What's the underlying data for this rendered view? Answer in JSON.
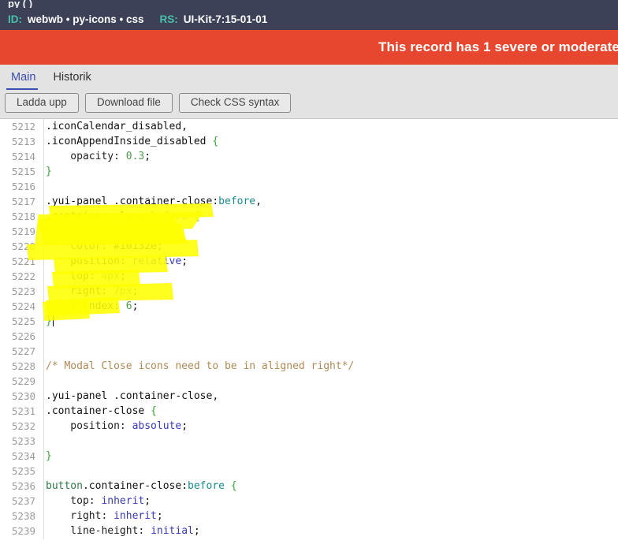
{
  "header": {
    "clipped_top_text": "                    py         (         )",
    "id_label": "ID:",
    "id_value": "webwb • py-icons • css",
    "rs_label": "RS:",
    "rs_value": "UI-Kit-7:15-01-01",
    "background_color": "#3c4158",
    "key_color": "#4bbfae"
  },
  "alert": {
    "text": "This record has 1 severe or moderate",
    "background_color": "#e8472f",
    "text_color": "#ffffff"
  },
  "tabs": [
    {
      "label": "Main",
      "active": true
    },
    {
      "label": "Historik",
      "active": false
    }
  ],
  "toolbar": {
    "buttons": [
      {
        "label": "Ladda upp"
      },
      {
        "label": "Download file"
      },
      {
        "label": "Check CSS syntax"
      }
    ]
  },
  "editor": {
    "first_line_number": 5212,
    "caret_line": 5225,
    "highlight_color": "#ffff00",
    "lines": [
      {
        "n": 5212,
        "tokens": [
          {
            "t": "sel",
            "s": ".iconCalendar_disabled,"
          }
        ]
      },
      {
        "n": 5213,
        "tokens": [
          {
            "t": "sel",
            "s": ".iconAppendInside_disabled "
          },
          {
            "t": "brace",
            "s": "{"
          }
        ]
      },
      {
        "n": 5214,
        "tokens": [
          {
            "t": "prop",
            "s": "    opacity: "
          },
          {
            "t": "num",
            "s": "0.3"
          },
          {
            "t": "plain",
            "s": ";"
          }
        ]
      },
      {
        "n": 5215,
        "tokens": [
          {
            "t": "brace",
            "s": "}"
          }
        ]
      },
      {
        "n": 5216,
        "tokens": []
      },
      {
        "n": 5217,
        "tokens": [
          {
            "t": "sel",
            "s": ".yui-panel .container-close:"
          },
          {
            "t": "pseudo",
            "s": "before"
          },
          {
            "t": "plain",
            "s": ","
          }
        ]
      },
      {
        "n": 5218,
        "tokens": [
          {
            "t": "sel",
            "s": ".container-close:"
          },
          {
            "t": "pseudo",
            "s": "before"
          },
          {
            "t": "plain",
            "s": " "
          },
          {
            "t": "brace",
            "s": "{"
          }
        ]
      },
      {
        "n": 5219,
        "tokens": [
          {
            "t": "prop",
            "s": "    font-size: "
          },
          {
            "t": "num",
            "s": "25px"
          },
          {
            "t": "plain",
            "s": ";"
          }
        ]
      },
      {
        "n": 5220,
        "tokens": [
          {
            "t": "prop",
            "s": "    color: "
          },
          {
            "t": "hex",
            "s": "#10132e"
          },
          {
            "t": "plain",
            "s": ";"
          }
        ]
      },
      {
        "n": 5221,
        "tokens": [
          {
            "t": "prop",
            "s": "    position: "
          },
          {
            "t": "kw",
            "s": "relative"
          },
          {
            "t": "plain",
            "s": ";"
          }
        ]
      },
      {
        "n": 5222,
        "tokens": [
          {
            "t": "prop",
            "s": "    top: "
          },
          {
            "t": "num",
            "s": "4px"
          },
          {
            "t": "plain",
            "s": ";"
          }
        ]
      },
      {
        "n": 5223,
        "tokens": [
          {
            "t": "prop",
            "s": "    right: "
          },
          {
            "t": "num",
            "s": "7px"
          },
          {
            "t": "plain",
            "s": ";"
          }
        ]
      },
      {
        "n": 5224,
        "tokens": [
          {
            "t": "prop",
            "s": "    z-index: "
          },
          {
            "t": "num",
            "s": "6"
          },
          {
            "t": "plain",
            "s": ";"
          }
        ]
      },
      {
        "n": 5225,
        "tokens": [
          {
            "t": "brace",
            "s": "}"
          }
        ],
        "caret": true
      },
      {
        "n": 5226,
        "tokens": []
      },
      {
        "n": 5227,
        "tokens": []
      },
      {
        "n": 5228,
        "tokens": [
          {
            "t": "comment",
            "s": "/* Modal Close icons need to be in aligned right*/"
          }
        ]
      },
      {
        "n": 5229,
        "tokens": []
      },
      {
        "n": 5230,
        "tokens": [
          {
            "t": "sel",
            "s": ".yui-panel .container-close,"
          }
        ]
      },
      {
        "n": 5231,
        "tokens": [
          {
            "t": "sel",
            "s": ".container-close "
          },
          {
            "t": "brace",
            "s": "{"
          }
        ]
      },
      {
        "n": 5232,
        "tokens": [
          {
            "t": "prop",
            "s": "    position: "
          },
          {
            "t": "kw",
            "s": "absolute"
          },
          {
            "t": "plain",
            "s": ";"
          }
        ]
      },
      {
        "n": 5233,
        "tokens": []
      },
      {
        "n": 5234,
        "tokens": [
          {
            "t": "brace",
            "s": "}"
          }
        ]
      },
      {
        "n": 5235,
        "tokens": []
      },
      {
        "n": 5236,
        "tokens": [
          {
            "t": "elem",
            "s": "button"
          },
          {
            "t": "sel",
            "s": ".container-close:"
          },
          {
            "t": "pseudo",
            "s": "before"
          },
          {
            "t": "plain",
            "s": " "
          },
          {
            "t": "brace",
            "s": "{"
          }
        ]
      },
      {
        "n": 5237,
        "tokens": [
          {
            "t": "prop",
            "s": "    top: "
          },
          {
            "t": "kw",
            "s": "inherit"
          },
          {
            "t": "plain",
            "s": ";"
          }
        ]
      },
      {
        "n": 5238,
        "tokens": [
          {
            "t": "prop",
            "s": "    right: "
          },
          {
            "t": "kw",
            "s": "inherit"
          },
          {
            "t": "plain",
            "s": ";"
          }
        ]
      },
      {
        "n": 5239,
        "tokens": [
          {
            "t": "prop",
            "s": "    line-height: "
          },
          {
            "t": "kw",
            "s": "initial"
          },
          {
            "t": "plain",
            "s": ";"
          }
        ]
      }
    ]
  }
}
